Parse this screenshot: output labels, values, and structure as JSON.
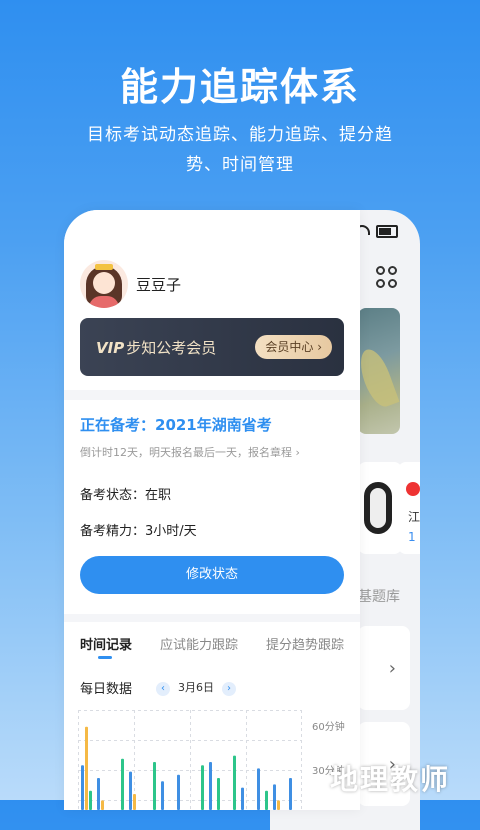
{
  "hero": {
    "title": "能力追踪体系",
    "subtitle": "目标考试动态追踪、能力追踪、提分趋势、时间管理"
  },
  "back_screen": {
    "bank_label": "基题库",
    "card_text1": "江",
    "card_text2": "1"
  },
  "profile": {
    "username": "豆豆子",
    "vip_prefix": "VIP",
    "vip_label": "步知公考会员",
    "vip_button": "会员中心 ›"
  },
  "prep": {
    "title": "正在备考：2021年湖南省考",
    "countdown": "倒计时12天，明天报名最后一天，报名章程 ›",
    "status_label": "备考状态：",
    "status_value": "在职",
    "energy_label": "备考精力：",
    "energy_value": "3小时/天",
    "modify_button": "修改状态"
  },
  "tabs": [
    {
      "label": "时间记录"
    },
    {
      "label": "应试能力跟踪"
    },
    {
      "label": "提分趋势跟踪"
    }
  ],
  "daily": {
    "title": "每日数据",
    "prev": "‹",
    "date": "3月6日",
    "next": "›"
  },
  "chart_data": {
    "type": "bar",
    "y_ticks": [
      "60分钟",
      "30分钟"
    ],
    "ylim": [
      0,
      60
    ],
    "colors": [
      "#3f8fe3",
      "#f5b945",
      "#2dc58a"
    ],
    "groups": [
      {
        "values": [
          28,
          52,
          12
        ]
      },
      {
        "values": [
          20,
          6,
          0
        ]
      },
      {
        "values": [
          0,
          0,
          32
        ]
      },
      {
        "values": [
          24,
          10,
          0
        ]
      },
      {
        "values": [
          0,
          0,
          30
        ]
      },
      {
        "values": [
          18,
          0,
          0
        ]
      },
      {
        "values": [
          22,
          0,
          0
        ]
      },
      {
        "values": [
          0,
          0,
          28
        ]
      },
      {
        "values": [
          30,
          0,
          20
        ]
      },
      {
        "values": [
          0,
          0,
          34
        ]
      },
      {
        "values": [
          14,
          0,
          0
        ]
      },
      {
        "values": [
          26,
          0,
          12
        ]
      },
      {
        "values": [
          16,
          6,
          0
        ]
      },
      {
        "values": [
          20,
          0,
          0
        ]
      }
    ]
  },
  "watermark": "地理教师"
}
